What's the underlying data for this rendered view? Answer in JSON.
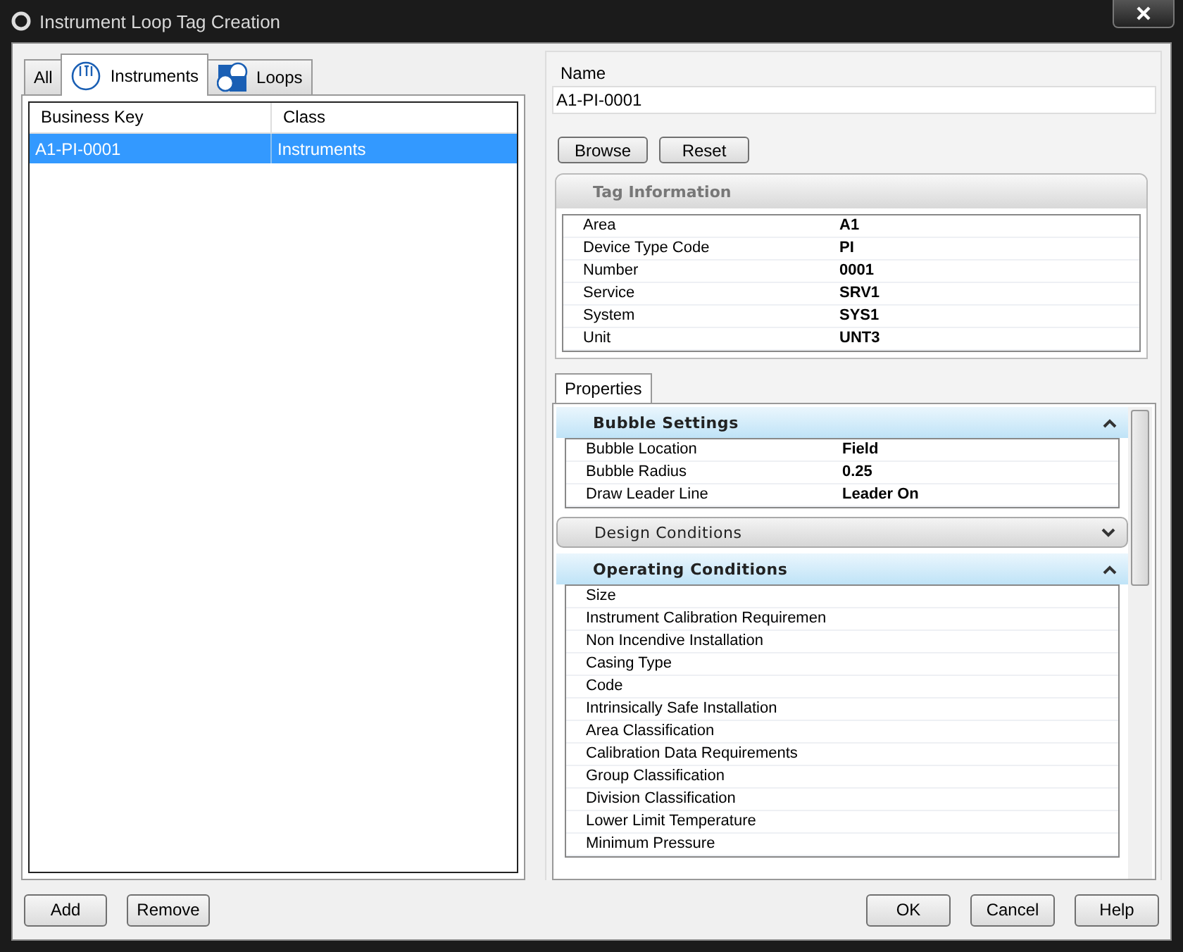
{
  "window": {
    "title": "Instrument Loop Tag Creation"
  },
  "tabs": [
    {
      "label": "All",
      "selected": false,
      "kind": "text"
    },
    {
      "label": "Instruments",
      "selected": true,
      "kind": "instrument"
    },
    {
      "label": "Loops",
      "selected": false,
      "kind": "loop"
    }
  ],
  "table": {
    "columns": [
      "Business Key",
      "Class"
    ],
    "rows": [
      {
        "cells": [
          "A1-PI-0001",
          "Instruments"
        ],
        "selected": true
      }
    ]
  },
  "name": {
    "label": "Name",
    "value": "A1-PI-0001"
  },
  "name_buttons": [
    "Browse",
    "Reset"
  ],
  "tag_information": {
    "title": "Tag Information",
    "rows": [
      {
        "label": "Area",
        "value": "A1"
      },
      {
        "label": "Device Type Code",
        "value": "PI"
      },
      {
        "label": "Number",
        "value": "0001"
      },
      {
        "label": "Service",
        "value": "SRV1"
      },
      {
        "label": "System",
        "value": "SYS1"
      },
      {
        "label": "Unit",
        "value": "UNT3"
      }
    ]
  },
  "properties_tab": "Properties",
  "sections": [
    {
      "title": "Bubble Settings",
      "expanded": true,
      "rows": [
        {
          "label": "Bubble Location",
          "value": "Field"
        },
        {
          "label": "Bubble Radius",
          "value": "0.25"
        },
        {
          "label": "Draw Leader Line",
          "value": "Leader On"
        }
      ]
    },
    {
      "title": "Design Conditions",
      "expanded": false
    },
    {
      "title": "Operating Conditions",
      "expanded": true,
      "rows": [
        {
          "label": "Size"
        },
        {
          "label": "Instrument Calibration Requiremen"
        },
        {
          "label": "Non Incendive Installation"
        },
        {
          "label": "Casing Type"
        },
        {
          "label": "Code"
        },
        {
          "label": "Intrinsically Safe Installation"
        },
        {
          "label": "Area Classification"
        },
        {
          "label": "Calibration Data Requirements"
        },
        {
          "label": "Group Classification"
        },
        {
          "label": "Division Classification"
        },
        {
          "label": "Lower Limit Temperature"
        },
        {
          "label": "Minimum Pressure"
        }
      ]
    }
  ],
  "left_buttons": [
    "Add",
    "Remove"
  ],
  "dialog_buttons": [
    "OK",
    "Cancel",
    "Help"
  ]
}
